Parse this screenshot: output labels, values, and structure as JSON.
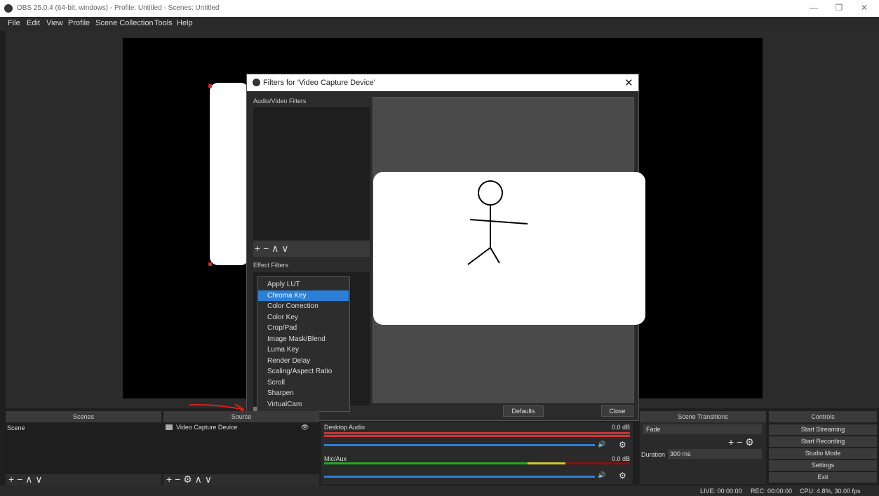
{
  "window": {
    "title": "OBS 25.0.4 (64-bit, windows) - Profile: Untitled - Scenes: Untitled",
    "minimize": "—",
    "restore": "❐",
    "close": "✕"
  },
  "menu": [
    "File",
    "Edit",
    "View",
    "Profile",
    "Scene Collection",
    "Tools",
    "Help"
  ],
  "dialog": {
    "title": "Filters for 'Video Capture Device'",
    "close": "✕",
    "av_filters_label": "Audio/Video Filters",
    "effect_filters_label": "Effect Filters",
    "tools": "+ − ∧ ∨",
    "defaults": "Defaults",
    "close_btn": "Close"
  },
  "context_menu": {
    "items": [
      "Apply LUT",
      "Chroma Key",
      "Color Correction",
      "Color Key",
      "Crop/Pad",
      "Image Mask/Blend",
      "Luma Key",
      "Render Delay",
      "Scaling/Aspect Ratio",
      "Scroll",
      "Sharpen",
      "VirtualCam"
    ],
    "selected_index": 1
  },
  "docks": {
    "scenes": {
      "title": "Scenes",
      "items": [
        "Scene"
      ],
      "tools": "+ − ∧ ∨"
    },
    "sources": {
      "title": "Source",
      "items": [
        "Video Capture Device"
      ],
      "tools": "+ − ⚙ ∧ ∨"
    },
    "mixer": {
      "channels": [
        {
          "name": "Desktop Audio",
          "db": "0.0 dB"
        },
        {
          "name": "Mic/Aux",
          "db": "0.0 dB"
        }
      ]
    },
    "transitions": {
      "title": "Scene Transitions",
      "type": "Fade",
      "duration_label": "Duration",
      "duration_value": "300 ms"
    },
    "controls": {
      "title": "Controls",
      "buttons": [
        "Start Streaming",
        "Start Recording",
        "Studio Mode",
        "Settings",
        "Exit"
      ]
    }
  },
  "status": {
    "live": "LIVE: 00:00:00",
    "rec": "REC: 00:00:00",
    "cpu": "CPU: 4.8%, 30.00 fps"
  },
  "colors": {
    "accent": "#2b7fd6",
    "annotation": "#d22020"
  }
}
